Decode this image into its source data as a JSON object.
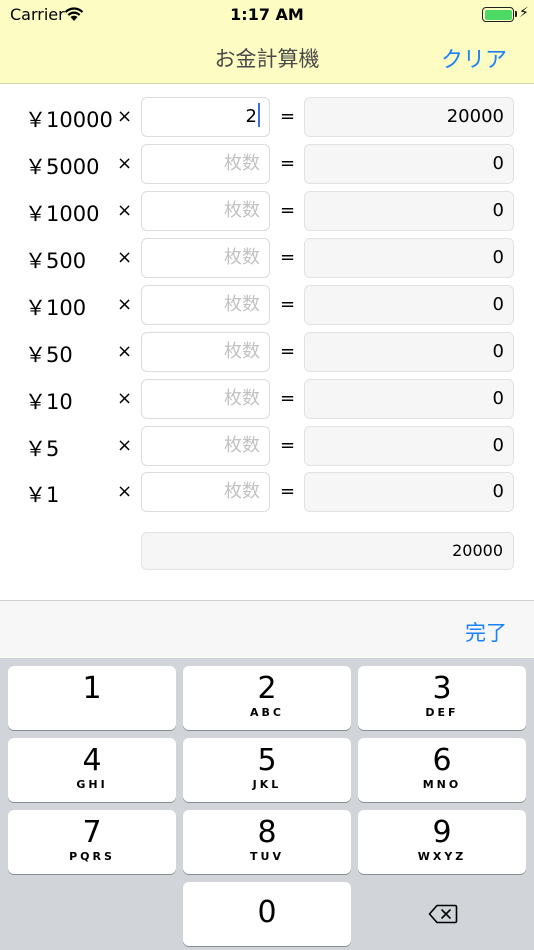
{
  "status": {
    "carrier": "Carrier",
    "time": "1:17 AM"
  },
  "nav": {
    "title": "お金計算機",
    "clear": "クリア"
  },
  "rows": [
    {
      "denom": "￥10000",
      "times": "×",
      "qty": "2",
      "equals": "=",
      "result": "20000"
    },
    {
      "denom": "￥5000",
      "times": "×",
      "qty": "",
      "equals": "=",
      "result": "0"
    },
    {
      "denom": "￥1000",
      "times": "×",
      "qty": "",
      "equals": "=",
      "result": "0"
    },
    {
      "denom": "￥500",
      "times": "×",
      "qty": "",
      "equals": "=",
      "result": "0"
    },
    {
      "denom": "￥100",
      "times": "×",
      "qty": "",
      "equals": "=",
      "result": "0"
    },
    {
      "denom": "￥50",
      "times": "×",
      "qty": "",
      "equals": "=",
      "result": "0"
    },
    {
      "denom": "￥10",
      "times": "×",
      "qty": "",
      "equals": "=",
      "result": "0"
    },
    {
      "denom": "￥5",
      "times": "×",
      "qty": "",
      "equals": "=",
      "result": "0"
    },
    {
      "denom": "￥1",
      "times": "×",
      "qty": "",
      "equals": "=",
      "result": "0"
    }
  ],
  "qty_placeholder": "枚数",
  "total": "20000",
  "accessory": {
    "done": "完了"
  },
  "keyboard": {
    "keys": [
      {
        "num": "1",
        "letters": ""
      },
      {
        "num": "2",
        "letters": "ABC"
      },
      {
        "num": "3",
        "letters": "DEF"
      },
      {
        "num": "4",
        "letters": "GHI"
      },
      {
        "num": "5",
        "letters": "JKL"
      },
      {
        "num": "6",
        "letters": "MNO"
      },
      {
        "num": "7",
        "letters": "PQRS"
      },
      {
        "num": "8",
        "letters": "TUV"
      },
      {
        "num": "9",
        "letters": "WXYZ"
      }
    ],
    "zero": "0",
    "backspace_icon": "backspace-icon"
  },
  "colors": {
    "header_bg": "#fdfdc3",
    "accent": "#1a82fb",
    "battery": "#4cd964"
  }
}
